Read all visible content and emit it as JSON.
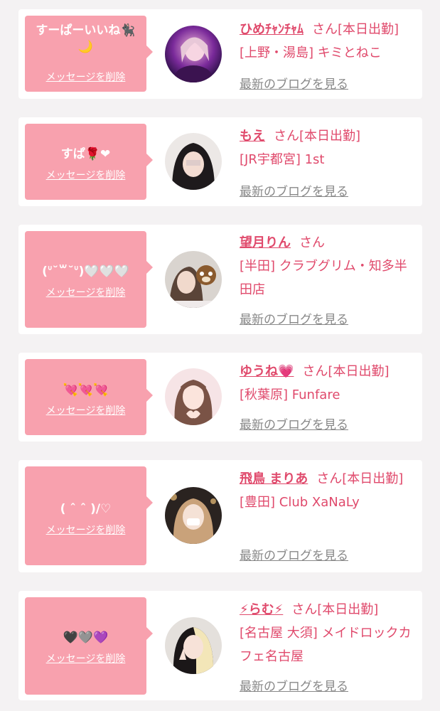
{
  "common": {
    "delete_label": "メッセージを削除",
    "blog_label": "最新のブログを見る",
    "honorific": "さん"
  },
  "colors": {
    "bubble": "#f8a1ae",
    "accent": "#e04a6c",
    "link_gray": "#888888",
    "background": "#f4f2f3"
  },
  "cards": [
    {
      "message_line1": "すーぱーいいね🐈‍⬛",
      "message_line2": "🌙",
      "cast_name": "ひめ𝆺𝅥",
      "name_display": "ひめﾁｬﾝﾁｬﾑ",
      "status": "[本日出勤]",
      "shop": "[上野・湯島] キミとねこ"
    },
    {
      "message_line1": "すぱ🌹❤",
      "message_line2": "",
      "cast_name": "もえ",
      "status": "[本日出勤]",
      "shop": "[JR宇都宮] 1st"
    },
    {
      "message_line1": "(ᐡ˘꒳˘ᐡ)🤍🤍🤍",
      "message_line2": "",
      "cast_name": "望月りん",
      "status": "",
      "shop": "[半田] クラブグリム・知多半田店"
    },
    {
      "message_line1": "💘💘💘",
      "message_line2": "",
      "cast_name": "ゆうね💗",
      "status": "[本日出勤]",
      "shop": "[秋葉原] Funfare"
    },
    {
      "message_line1": "( ˆ ˆ )/♡",
      "message_line2": "",
      "cast_name": "飛鳥 まりあ",
      "status": "[本日出勤]",
      "shop": "[豊田] Club XaNaLy"
    },
    {
      "message_line1": "🖤🩶💜",
      "message_line2": "",
      "cast_name": "⚡らむ⚡",
      "status": "[本日出勤]",
      "shop": "[名古屋 大須] メイドロックカフェ名古屋"
    }
  ]
}
